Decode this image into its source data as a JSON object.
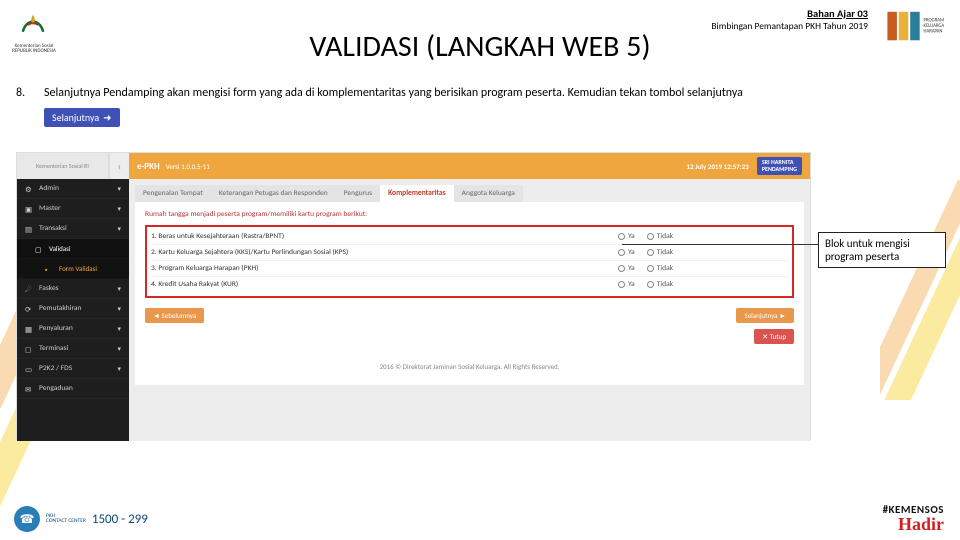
{
  "header": {
    "logo_left_alt": "Kementerian Sosial",
    "logo_left_sub": "REPUBLIK INDONESIA",
    "meta_line1": "Bahan Ajar 03",
    "meta_line2": "Bimbingan Pemantapan PKH Tahun 2019",
    "logo_right_alt": "Program Keluarga Harapan",
    "title": "VALIDASI (LANGKAH WEB 5)"
  },
  "bullet": {
    "num": "8.",
    "text": "Selanjutnya Pendamping akan mengisi form yang ada di komplementaritas yang berisikan program peserta. Kemudian tekan tombol selanjutnya",
    "button_label": "Selanjutnya"
  },
  "screenshot": {
    "logo_text": "Kementerian Sosial RI",
    "brand": "e-PKH",
    "brand_sub": "Versi 1.0.0.5-11",
    "datetime": "12 July 2019 12:57:23",
    "user_name": "SRI HARNITA",
    "user_role": "PENDAMPING",
    "sidebar": [
      {
        "label": "Admin",
        "icon": "gear-icon",
        "expandable": true
      },
      {
        "label": "Master",
        "icon": "folder-icon",
        "expandable": true
      },
      {
        "label": "Transaksi",
        "icon": "file-icon",
        "expandable": true
      },
      {
        "label": "Validasi",
        "icon": "check-icon",
        "sub": true,
        "active": true
      },
      {
        "label": "Form Validasi",
        "icon": "form-icon",
        "sub2": true
      },
      {
        "label": "Faskes",
        "icon": "hospital-icon",
        "expandable": true
      },
      {
        "label": "Pemutakhiran",
        "icon": "refresh-icon",
        "expandable": true
      },
      {
        "label": "Penyaluran",
        "icon": "money-icon",
        "expandable": true
      },
      {
        "label": "Terminasi",
        "icon": "stop-icon",
        "expandable": true
      },
      {
        "label": "P2K2 / FDS",
        "icon": "book-icon",
        "expandable": true
      },
      {
        "label": "Pengaduan",
        "icon": "chat-icon",
        "expandable": true
      }
    ],
    "tabs": [
      {
        "label": "Pengenalan Tempat",
        "active": false
      },
      {
        "label": "Keterangan Petugas dan Responden",
        "active": false
      },
      {
        "label": "Pengurus",
        "active": false
      },
      {
        "label": "Komplementaritas",
        "active": true
      },
      {
        "label": "Anggota Keluarga",
        "active": false
      }
    ],
    "panel_title": "Rumah tangga menjadi peserta program/memiliki kartu program berikut:",
    "rows": [
      {
        "num": "1.",
        "label": "Beras untuk Kesejahteraan (Rastra/BPNT)"
      },
      {
        "num": "2.",
        "label": "Kartu Keluarga Sejahtera (KKS)/Kartu Perlindungan Sosial (KPS)"
      },
      {
        "num": "3.",
        "label": "Program Keluarga Harapan (PKH)"
      },
      {
        "num": "4.",
        "label": "Kredit Usaha Rakyat (KUR)"
      }
    ],
    "radio_yes": "Ya",
    "radio_no": "Tidak",
    "btn_prev": "◄ Sebelumnya",
    "btn_next": "Selanjutnya ►",
    "btn_close": "✕ Tutup",
    "footer": "2016 © Direktorat Jaminan Sosial Keluarga. All Rights Reserved."
  },
  "callout": "Blok untuk mengisi program peserta",
  "bottom": {
    "phone_label_top": "PKH",
    "phone_label_mid": "CONTACT CENTER",
    "phone_number": "1500 - 299",
    "hadir_hash": "#KEMENSOS",
    "hadir_script": "Hadir"
  }
}
